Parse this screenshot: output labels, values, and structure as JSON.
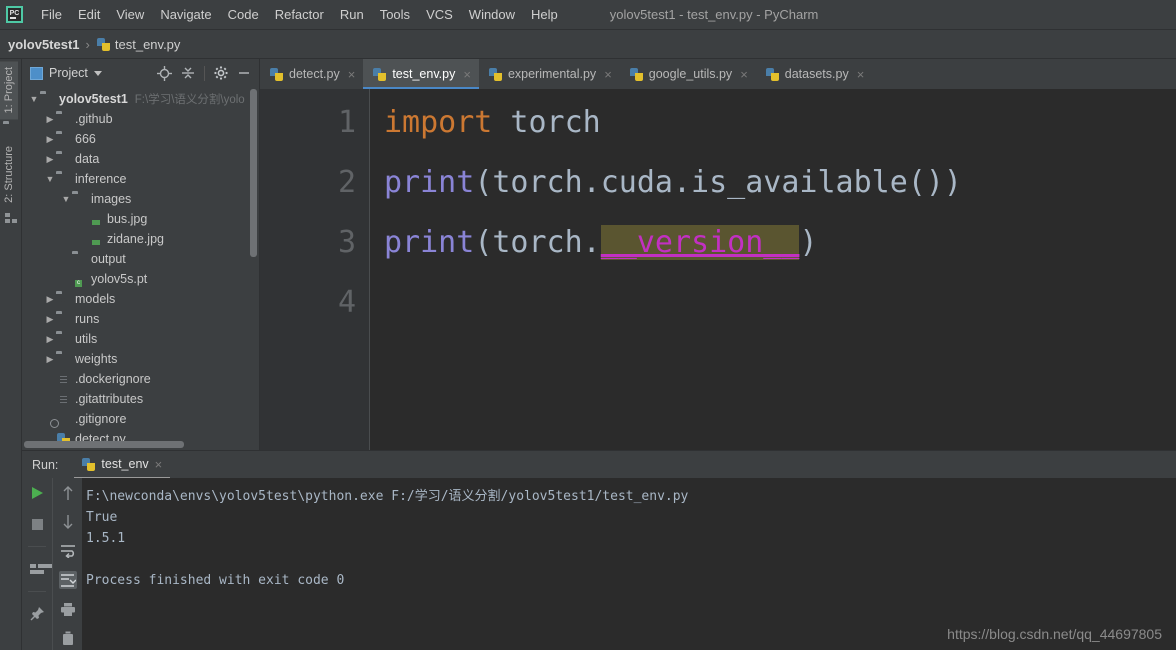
{
  "window": {
    "title": "yolov5test1 - test_env.py - PyCharm",
    "logo_text": "PC"
  },
  "menubar": {
    "items": [
      {
        "label": "File"
      },
      {
        "label": "Edit"
      },
      {
        "label": "View"
      },
      {
        "label": "Navigate"
      },
      {
        "label": "Code"
      },
      {
        "label": "Refactor"
      },
      {
        "label": "Run"
      },
      {
        "label": "Tools"
      },
      {
        "label": "VCS"
      },
      {
        "label": "Window"
      },
      {
        "label": "Help"
      }
    ]
  },
  "breadcrumb": {
    "project": "yolov5test1",
    "separator": "›",
    "file": "test_env.py"
  },
  "toolstrip": {
    "tabs": [
      {
        "label": "1: Project",
        "icon": "project-icon",
        "active": true
      },
      {
        "label": "2: Structure",
        "icon": "structure-icon",
        "active": false
      }
    ]
  },
  "project_panel": {
    "title": "Project",
    "icons": [
      {
        "name": "locate-icon"
      },
      {
        "name": "collapse-all-icon"
      },
      {
        "name": "gear-icon"
      },
      {
        "name": "minimize-icon"
      }
    ],
    "tree": [
      {
        "label": "yolov5test1",
        "path": "F:\\学习\\语义分割\\yolo",
        "arrow": "down",
        "icon": "folder",
        "depth": 0,
        "bold": true
      },
      {
        "label": ".github",
        "arrow": "right",
        "icon": "folder",
        "depth": 1
      },
      {
        "label": "666",
        "arrow": "right",
        "icon": "folder",
        "depth": 1
      },
      {
        "label": "data",
        "arrow": "right",
        "icon": "folder",
        "depth": 1
      },
      {
        "label": "inference",
        "arrow": "down",
        "icon": "folder",
        "depth": 1
      },
      {
        "label": "images",
        "arrow": "down",
        "icon": "folder",
        "depth": 2
      },
      {
        "label": "bus.jpg",
        "arrow": "none",
        "icon": "image",
        "depth": 3
      },
      {
        "label": "zidane.jpg",
        "arrow": "none",
        "icon": "image",
        "depth": 3
      },
      {
        "label": "output",
        "arrow": "none",
        "icon": "folder",
        "depth": 2
      },
      {
        "label": "yolov5s.pt",
        "arrow": "none",
        "icon": "pt",
        "depth": 2
      },
      {
        "label": "models",
        "arrow": "right",
        "icon": "folder-mod",
        "depth": 1
      },
      {
        "label": "runs",
        "arrow": "right",
        "icon": "folder",
        "depth": 1
      },
      {
        "label": "utils",
        "arrow": "right",
        "icon": "folder-mod",
        "depth": 1
      },
      {
        "label": "weights",
        "arrow": "right",
        "icon": "folder",
        "depth": 1
      },
      {
        "label": ".dockerignore",
        "arrow": "none",
        "icon": "file",
        "depth": 1
      },
      {
        "label": ".gitattributes",
        "arrow": "none",
        "icon": "file",
        "depth": 1
      },
      {
        "label": ".gitignore",
        "arrow": "none",
        "icon": "git",
        "depth": 1
      },
      {
        "label": "detect.py",
        "arrow": "none",
        "icon": "py",
        "depth": 1
      }
    ]
  },
  "editor": {
    "tabs": [
      {
        "label": "detect.py",
        "active": false
      },
      {
        "label": "test_env.py",
        "active": true
      },
      {
        "label": "experimental.py",
        "active": false
      },
      {
        "label": "google_utils.py",
        "active": false
      },
      {
        "label": "datasets.py",
        "active": false
      }
    ],
    "close_glyph": "×",
    "line_numbers": [
      "1",
      "2",
      "3",
      "4"
    ],
    "lines": [
      {
        "num": "1",
        "parts": [
          {
            "text": "import",
            "style": "kw"
          },
          {
            "text": " torch",
            "style": "pl"
          }
        ]
      },
      {
        "num": "2",
        "parts": [
          {
            "text": "print",
            "style": "fn"
          },
          {
            "text": "(torch.cuda.is_available())",
            "style": "pl"
          }
        ]
      },
      {
        "num": "3",
        "parts": [
          {
            "text": "print",
            "style": "fn"
          },
          {
            "text": "(torch.",
            "style": "pl"
          },
          {
            "text": "__version__",
            "style": "dunder"
          },
          {
            "text": ")",
            "style": "pl"
          }
        ]
      },
      {
        "num": "4",
        "parts": []
      }
    ]
  },
  "run_panel": {
    "label": "Run:",
    "tab_label": "test_env",
    "close_glyph": "×",
    "left_tools": [
      {
        "name": "run-icon"
      },
      {
        "name": "stop-icon"
      },
      {
        "name": "layout-icon"
      },
      {
        "name": "pin-icon"
      }
    ],
    "right_tools": [
      {
        "name": "arrow-up-icon"
      },
      {
        "name": "arrow-down-icon"
      },
      {
        "name": "soft-wrap-icon"
      },
      {
        "name": "scroll-to-end-icon"
      },
      {
        "name": "print-icon"
      },
      {
        "name": "trash-icon"
      }
    ],
    "console_lines": [
      "F:\\newconda\\envs\\yolov5test\\python.exe F:/学习/语义分割/yolov5test1/test_env.py",
      "True",
      "1.5.1",
      "",
      "Process finished with exit code 0"
    ]
  },
  "watermark": "https://blog.csdn.net/qq_44697805",
  "colors": {
    "chrome": "#3c3f41",
    "editor_bg": "#2b2b2b",
    "gutter_bg": "#313335",
    "keyword": "#cc7832",
    "function": "#8a84d6",
    "plain": "#a9b7c6",
    "dunder": "#c230c2",
    "selection": "#5a5530",
    "tab_underline": "#4a88c7",
    "run_green": "#4caf50"
  }
}
